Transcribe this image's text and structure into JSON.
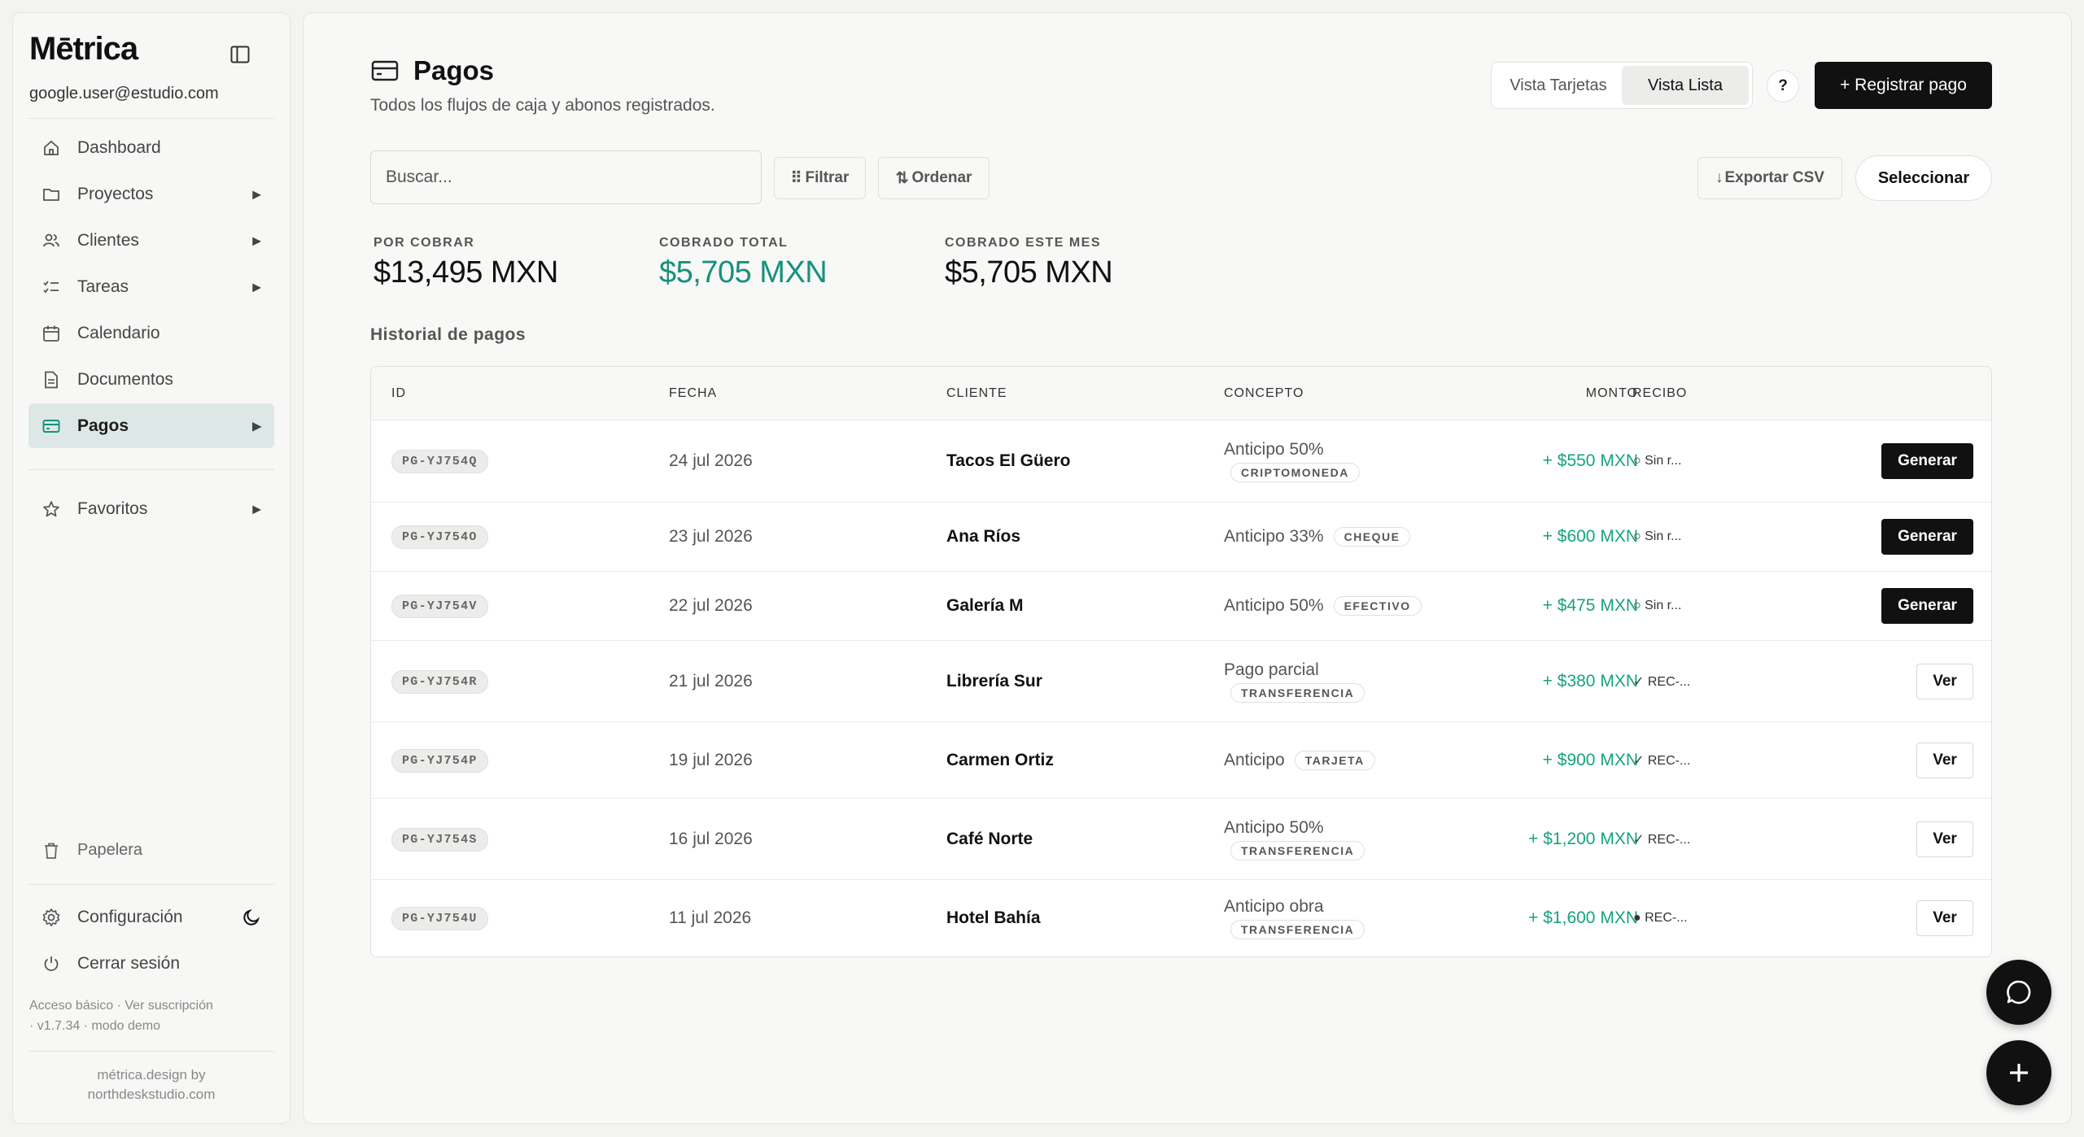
{
  "sidebar": {
    "brand": "Mētrica",
    "user_email": "google.user@estudio.com",
    "nav": [
      {
        "label": "Dashboard",
        "icon": "home-icon",
        "has_arrow": false
      },
      {
        "label": "Proyectos",
        "icon": "folder-icon",
        "has_arrow": true
      },
      {
        "label": "Clientes",
        "icon": "users-icon",
        "has_arrow": true
      },
      {
        "label": "Tareas",
        "icon": "tasks-icon",
        "has_arrow": true
      },
      {
        "label": "Calendario",
        "icon": "calendar-icon",
        "has_arrow": false
      },
      {
        "label": "Documentos",
        "icon": "document-icon",
        "has_arrow": false
      },
      {
        "label": "Pagos",
        "icon": "card-icon",
        "has_arrow": true,
        "active": true
      }
    ],
    "favorites": "Favoritos",
    "trash": "Papelera",
    "settings": "Configuración",
    "logout": "Cerrar sesión",
    "plan_line1": "Acceso básico · Ver suscripción",
    "plan_line2": "· v1.7.34 · modo demo",
    "credit_line1": "métrica.design by",
    "credit_line2": "northdeskstudio.com"
  },
  "header": {
    "title": "Pagos",
    "subtitle": "Todos los flujos de caja y abonos registrados.",
    "view_cards": "Vista Tarjetas",
    "view_list": "Vista Lista",
    "help": "?",
    "register": "+ Registrar pago"
  },
  "toolbar": {
    "search_placeholder": "Buscar...",
    "filter": "Filtrar",
    "sort": "Ordenar",
    "export": "Exportar CSV",
    "select": "Seleccionar"
  },
  "stats": [
    {
      "label": "POR COBRAR",
      "value": "$13,495 MXN",
      "color": "#111111"
    },
    {
      "label": "COBRADO TOTAL",
      "value": "$5,705 MXN",
      "color": "#16917c"
    },
    {
      "label": "COBRADO ESTE MES",
      "value": "$5,705 MXN",
      "color": "#111111"
    }
  ],
  "history_title": "Historial de pagos",
  "table": {
    "columns": [
      "ID",
      "FECHA",
      "CLIENTE",
      "CONCEPTO",
      "MONTO",
      "RECIBO"
    ],
    "rows": [
      {
        "id": "PG-YJ754Q",
        "date": "24 jul 2026",
        "client": "Tacos El Güero",
        "concept": "Anticipo 50%",
        "method": "CRIPTOMONEDA",
        "amount": "+ $550 MXN",
        "receipt": "○ Sin r...",
        "action": "Generar"
      },
      {
        "id": "PG-YJ754O",
        "date": "23 jul 2026",
        "client": "Ana Ríos",
        "concept": "Anticipo 33%",
        "method": "CHEQUE",
        "amount": "+ $600 MXN",
        "receipt": "○ Sin r...",
        "action": "Generar"
      },
      {
        "id": "PG-YJ754V",
        "date": "22 jul 2026",
        "client": "Galería M",
        "concept": "Anticipo 50%",
        "method": "EFECTIVO",
        "amount": "+ $475 MXN",
        "receipt": "○ Sin r...",
        "action": "Generar"
      },
      {
        "id": "PG-YJ754R",
        "date": "21 jul 2026",
        "client": "Librería Sur",
        "concept": "Pago parcial",
        "method": "TRANSFERENCIA",
        "amount": "+ $380 MXN",
        "receipt": "✓ REC-...",
        "action": "Ver"
      },
      {
        "id": "PG-YJ754P",
        "date": "19 jul 2026",
        "client": "Carmen Ortiz",
        "concept": "Anticipo",
        "method": "TARJETA",
        "amount": "+ $900 MXN",
        "receipt": "✓ REC-...",
        "action": "Ver"
      },
      {
        "id": "PG-YJ754S",
        "date": "16 jul 2026",
        "client": "Café Norte",
        "concept": "Anticipo 50%",
        "method": "TRANSFERENCIA",
        "amount": "+ $1,200 MXN",
        "receipt": "✓ REC-...",
        "action": "Ver"
      },
      {
        "id": "PG-YJ754U",
        "date": "11 jul 2026",
        "client": "Hotel Bahía",
        "concept": "Anticipo obra",
        "method": "TRANSFERENCIA",
        "amount": "+ $1,600 MXN",
        "receipt": "● REC-...",
        "action": "Ver"
      }
    ]
  },
  "colors": {
    "accent": "#16917c",
    "amount": "#16a37f",
    "active_nav": "#dde8e6",
    "primary": "#111111"
  }
}
